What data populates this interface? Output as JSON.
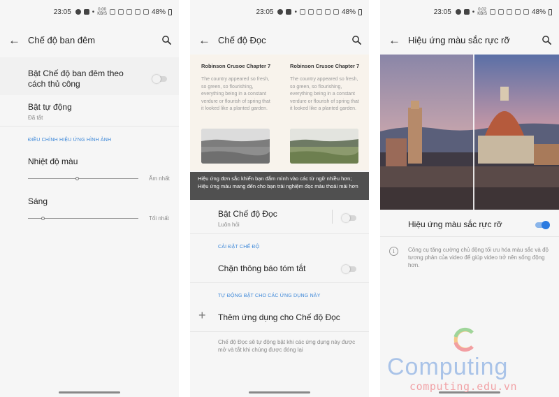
{
  "status": {
    "time": "23:05",
    "speed_value": "0.00",
    "speed_unit": "KB/S",
    "speed2_value": "0.02",
    "battery": "48%"
  },
  "screen1": {
    "title": "Chế độ ban đêm",
    "manual_label": "Bật Chế độ ban đêm theo cách thủ công",
    "manual_on": false,
    "auto_label": "Bật tự động",
    "auto_sub": "Đã tắt",
    "section": "ĐIỀU CHỈNH HIỆU ỨNG HÌNH ẢNH",
    "temp_label": "Nhiệt độ màu",
    "temp_end": "Ấm nhất",
    "temp_level": 0.45,
    "bright_label": "Sáng",
    "bright_end": "Tối nhất",
    "bright_level": 0.14
  },
  "screen2": {
    "title": "Chế độ Đọc",
    "book_title_left": "Robinson Crusoe Chapter 7",
    "book_title_right": "Robinson Crusoe Chapter 7",
    "book_text": "The country appeared so fresh, so green, so flourishing, everything being in a constant verdure or flourish of spring that it looked like a planted garden.",
    "banner": "Hiệu ứng đơn sắc khiến bạn đắm mình vào các từ ngữ nhiều hơn; Hiệu ứng màu mang đến cho bạn trải nghiệm đọc màu thoải mái hơn",
    "enable_label": "Bật Chế độ Đọc",
    "enable_sub": "Luôn hỏi",
    "enable_on": false,
    "section1": "CÀI ĐẶT CHẾ ĐỘ",
    "block_label": "Chặn thông báo tóm tắt",
    "block_on": false,
    "section2": "TỰ ĐỘNG BẬT CHO CÁC ỨNG DỤNG NÀY",
    "add_label": "Thêm ứng dụng cho Chế độ Đọc",
    "footer": "Chế độ Đọc sẽ tự động bật khi các ứng dụng này được mở và tắt khi chúng được đóng lại"
  },
  "screen3": {
    "title": "Hiệu ứng màu sắc rực rỡ",
    "vivid_label": "Hiệu ứng màu sắc rực rỡ",
    "vivid_on": true,
    "info": "Công cụ tăng cường chủ động tối ưu hóa màu sắc và độ tương phản của video để giúp video trở nên sống động hơn."
  },
  "watermark": {
    "brand": "Computing",
    "url": "computing.edu.vn"
  },
  "colors": {
    "accent": "#3a86d8",
    "toggle_on": "#2c7be0",
    "banner_bg": "#505050",
    "reading_bg": "#f8f3ec"
  }
}
